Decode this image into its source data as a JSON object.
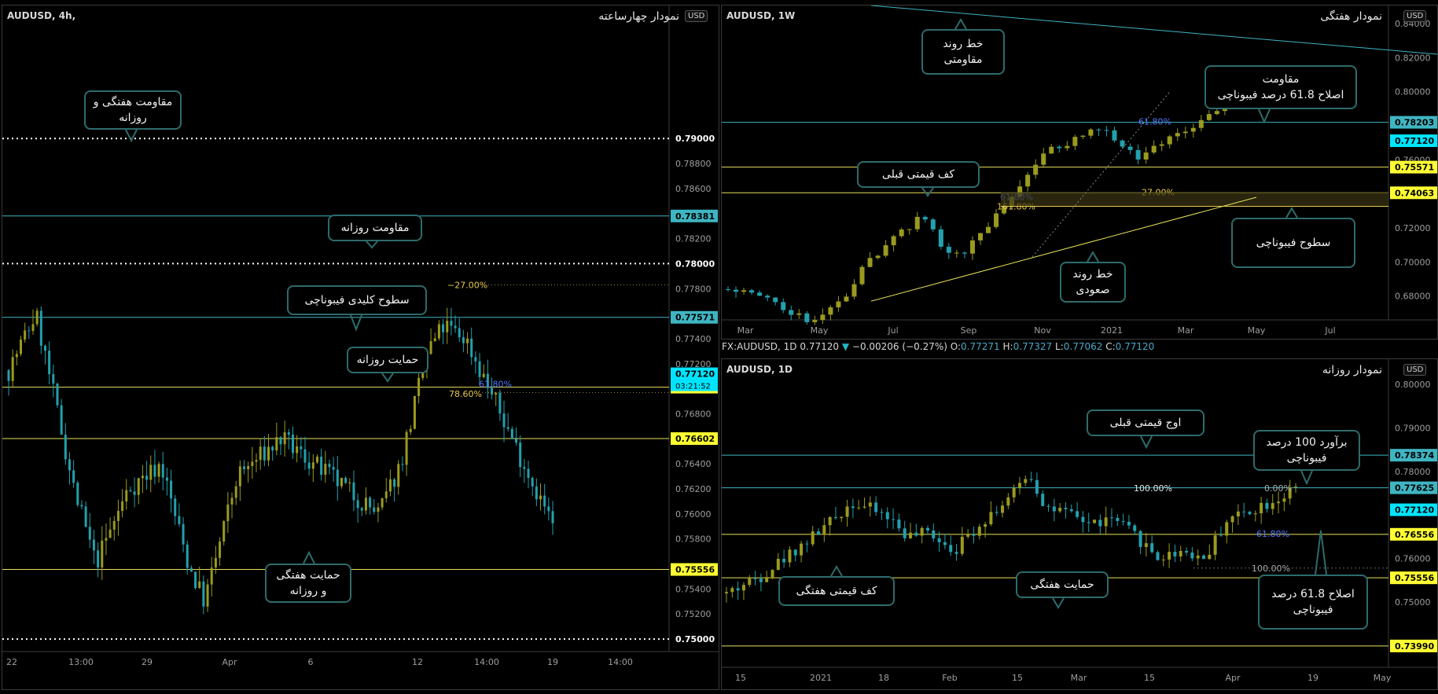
{
  "colors": {
    "background": "#000000",
    "bull": "#9a9a1f",
    "bear": "#23a0ad",
    "yellow_line": "#e8e25a",
    "cyan_line": "#3fb5c2",
    "note_border": "#2e6b6b",
    "axis_text": "#9e9e9e"
  },
  "info_bar": {
    "symbol": "FX:AUDUSD, 1D",
    "price": "0.77120",
    "change": "−0.00206 (−0.27%)",
    "arrow": "▼",
    "o_label": "O:",
    "o": "0.77271",
    "h_label": "H:",
    "h": "0.77327",
    "l_label": "L:",
    "l": "0.77062",
    "c_label": "C:",
    "c": "0.77120"
  },
  "chart_data": [
    {
      "type": "candlestick",
      "symbol": "AUDUSD, 4h,",
      "title": "نمودار چهارساعته",
      "currency": "USD",
      "ylim": [
        0.749,
        0.8
      ],
      "y_ticks": [
        "0.78800",
        "0.78600",
        "0.78200",
        "0.77800",
        "0.77400",
        "0.77200",
        "0.76800",
        "0.76400",
        "0.76200",
        "0.76000",
        "0.75800",
        "0.75400",
        "0.75200"
      ],
      "x_ticks": [
        "22",
        "13:00",
        "29",
        "Apr",
        "6",
        "12",
        "14:00",
        "19",
        "14:00"
      ],
      "last_price": 0.7712,
      "countdown": "03:21:52",
      "horizontal_lines": [
        {
          "value": 0.79,
          "label": "0.79000",
          "style": "dotted-white"
        },
        {
          "value": 0.78381,
          "label": "0.78381",
          "style": "cyan"
        },
        {
          "value": 0.78,
          "label": "0.78000",
          "style": "dotted-white"
        },
        {
          "value": 0.77571,
          "label": "0.77571",
          "style": "cyan"
        },
        {
          "value": 0.77013,
          "label": "0.77013",
          "style": "yellow"
        },
        {
          "value": 0.76602,
          "label": "0.76602",
          "style": "yellow"
        },
        {
          "value": 0.75556,
          "label": "0.75556",
          "style": "yellow"
        },
        {
          "value": 0.75,
          "label": "0.75000",
          "style": "dotted-white"
        }
      ],
      "fib_labels": [
        {
          "text": "−27.00%",
          "value": 0.7783
        },
        {
          "text": "78.60%",
          "value": 0.7696
        },
        {
          "text": "61.80%",
          "value": 0.7704
        }
      ],
      "annotations": [
        {
          "text": "مقاومت هفتگی و\nروزانه"
        },
        {
          "text": "مقاومت روزانه"
        },
        {
          "text": "سطوح کلیدی فیبوناچی"
        },
        {
          "text": "حمایت روزانه"
        },
        {
          "text": "حمایت هفتگی\nو روزانه"
        }
      ]
    },
    {
      "type": "candlestick",
      "symbol": "AUDUSD, 1W",
      "title": "نمودار هفتگی",
      "currency": "USD",
      "ylim": [
        0.666,
        0.846
      ],
      "y_ticks": [
        "0.84000",
        "0.82000",
        "0.80000",
        "0.76000",
        "0.72000",
        "0.70000",
        "0.68000"
      ],
      "x_ticks": [
        "Mar",
        "May",
        "Jul",
        "Sep",
        "Nov",
        "2021",
        "Mar",
        "May",
        "Jul"
      ],
      "last_price": 0.7712,
      "horizontal_lines": [
        {
          "value": 0.78203,
          "label": "0.78203",
          "style": "cyan"
        },
        {
          "value": 0.7712,
          "label": "0.77120",
          "style": "last"
        },
        {
          "value": 0.75571,
          "label": "0.75571",
          "style": "yellow"
        },
        {
          "value": 0.74063,
          "label": "0.74063",
          "style": "yellow"
        }
      ],
      "fib_labels": [
        {
          "text": "61.80%",
          "value": 0.7825
        },
        {
          "text": "61.80%",
          "value": 0.7383
        },
        {
          "text": "161.80%",
          "value": 0.7327
        },
        {
          "text": "27.00%",
          "value": 0.7409
        }
      ],
      "annotations": [
        {
          "text": "خط روند\nمقاومتی"
        },
        {
          "text": "مقاومت\nاصلاح 61.8 درصد فیبوناچی"
        },
        {
          "text": "کف قیمتی قبلی"
        },
        {
          "text": "سطوح فیبوناچی"
        },
        {
          "text": "خط روند\nصعودی"
        }
      ]
    },
    {
      "type": "candlestick",
      "symbol": "AUDUSD, 1D",
      "title": "نمودار روزانه",
      "currency": "USD",
      "ylim": [
        0.735,
        0.804
      ],
      "y_ticks": [
        "0.80000",
        "0.79000",
        "0.78000",
        "0.76000",
        "0.75000"
      ],
      "x_ticks": [
        "15",
        "2021",
        "18",
        "Feb",
        "15",
        "Mar",
        "15",
        "Apr",
        "19",
        "May"
      ],
      "last_price": 0.7712,
      "horizontal_lines": [
        {
          "value": 0.78374,
          "label": "0.78374",
          "style": "cyan"
        },
        {
          "value": 0.77625,
          "label": "0.77625",
          "style": "cyan"
        },
        {
          "value": 0.7712,
          "label": "0.77120",
          "style": "last"
        },
        {
          "value": 0.76556,
          "label": "0.76556",
          "style": "yellow"
        },
        {
          "value": 0.75556,
          "label": "0.75556",
          "style": "yellow"
        },
        {
          "value": 0.7399,
          "label": "0.73990",
          "style": "yellow"
        }
      ],
      "fib_labels": [
        {
          "text": "100.00%",
          "value": 0.7762
        },
        {
          "text": "0.00%",
          "value": 0.7762
        },
        {
          "text": "61.80%",
          "value": 0.7657
        },
        {
          "text": "100.00%",
          "value": 0.7578
        }
      ],
      "annotations": [
        {
          "text": "اوج قیمتی قبلی"
        },
        {
          "text": "برآورد 100 درصد\nفیبوناچی"
        },
        {
          "text": "کف قیمتی هفتگی"
        },
        {
          "text": "حمایت هفتگی"
        },
        {
          "text": "اصلاح 61.8 درصد\nفیبوناچی"
        }
      ]
    }
  ]
}
